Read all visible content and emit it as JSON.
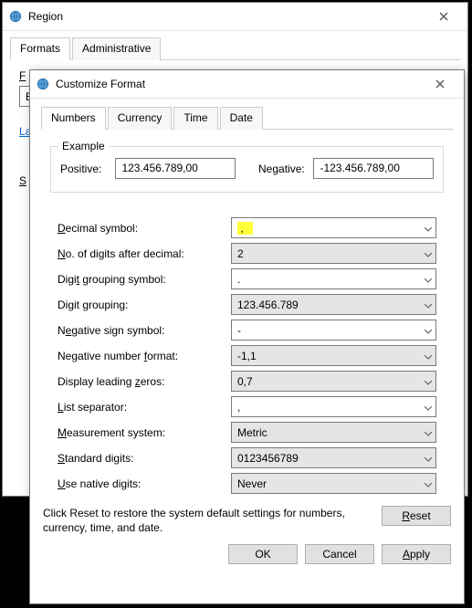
{
  "region_window": {
    "title": "Region",
    "tabs": {
      "formats": "Formats",
      "admin": "Administrative"
    },
    "format_label_initial": "F",
    "english_initial": "E",
    "lang_initial": "La",
    "sort_initial": "S"
  },
  "customize_window": {
    "title": "Customize Format",
    "tabs": {
      "numbers": "Numbers",
      "currency": "Currency",
      "time": "Time",
      "date": "Date"
    },
    "example": {
      "legend": "Example",
      "positive_label": "Positive:",
      "positive_value": "123.456.789,00",
      "negative_label": "Negative:",
      "negative_value": "-123.456.789,00"
    },
    "fields": {
      "decimal_symbol": {
        "label_pre": "",
        "label_u": "D",
        "label_post": "ecimal symbol:",
        "value": ",",
        "bg": "white",
        "highlight": true
      },
      "digits_after": {
        "label_pre": "",
        "label_u": "N",
        "label_post": "o. of digits after decimal:",
        "value": "2",
        "bg": "grey"
      },
      "grouping_symbol": {
        "label_pre": "Digi",
        "label_u": "t",
        "label_post": " grouping symbol:",
        "value": ".",
        "bg": "white"
      },
      "digit_grouping": {
        "label_pre": "Digit ",
        "label_u": "g",
        "label_post": "rouping:",
        "value": "123.456.789",
        "bg": "grey"
      },
      "neg_sign": {
        "label_pre": "N",
        "label_u": "e",
        "label_post": "gative sign symbol:",
        "value": "-",
        "bg": "white"
      },
      "neg_format": {
        "label_pre": "Negative number ",
        "label_u": "f",
        "label_post": "ormat:",
        "value": "-1,1",
        "bg": "grey"
      },
      "leading_zeros": {
        "label_pre": "Display leading ",
        "label_u": "z",
        "label_post": "eros:",
        "value": "0,7",
        "bg": "grey"
      },
      "list_separator": {
        "label_pre": "",
        "label_u": "L",
        "label_post": "ist separator:",
        "value": ",",
        "bg": "white"
      },
      "measurement": {
        "label_pre": "",
        "label_u": "M",
        "label_post": "easurement system:",
        "value": "Metric",
        "bg": "grey"
      },
      "standard_digits": {
        "label_pre": "",
        "label_u": "S",
        "label_post": "tandard digits:",
        "value": "0123456789",
        "bg": "grey"
      },
      "native_digits": {
        "label_pre": "",
        "label_u": "U",
        "label_post": "se native digits:",
        "value": "Never",
        "bg": "grey"
      }
    },
    "reset_note": "Click Reset to restore the system default settings for numbers, currency, time, and date.",
    "buttons": {
      "reset_u": "R",
      "reset_post": "eset",
      "ok": "OK",
      "cancel": "Cancel",
      "apply_u": "A",
      "apply_post": "pply"
    }
  }
}
